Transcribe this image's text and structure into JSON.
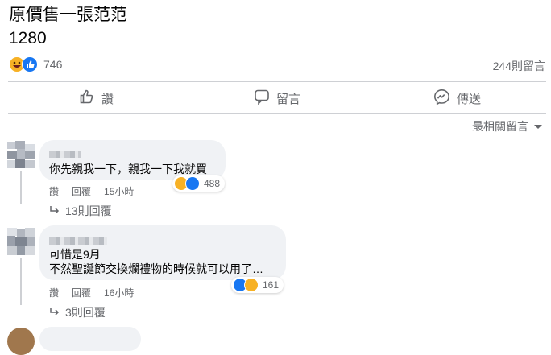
{
  "post": {
    "line1": "原價售一張范范",
    "line2": "1280"
  },
  "stats": {
    "reaction_count": "746",
    "comment_count": "244則留言"
  },
  "actions": {
    "like": "讚",
    "comment": "留言",
    "share": "傳送"
  },
  "sort_label": "最相關留言",
  "comments": [
    {
      "lines": [
        "你先親我一下，親我一下我就買"
      ],
      "like_action": "讚",
      "reply_action": "回覆",
      "time": "15小時",
      "reaction_count": "488",
      "replies_label": "13則回覆"
    },
    {
      "lines": [
        "可惜是9月",
        "不然聖誕節交換爛禮物的時候就可以用了…"
      ],
      "like_action": "讚",
      "reply_action": "回覆",
      "time": "16小時",
      "reaction_count": "161",
      "replies_label": "3則回覆"
    }
  ],
  "colors": {
    "like_blue": "#1877f2",
    "haha_yellow": "#f7b125",
    "muted": "#65676b",
    "bubble": "#f0f2f5"
  },
  "icons": [
    "haha-icon",
    "like-icon",
    "thumbs-up-icon",
    "comment-icon",
    "messenger-icon",
    "caret-down-icon",
    "reply-arrow-icon"
  ]
}
